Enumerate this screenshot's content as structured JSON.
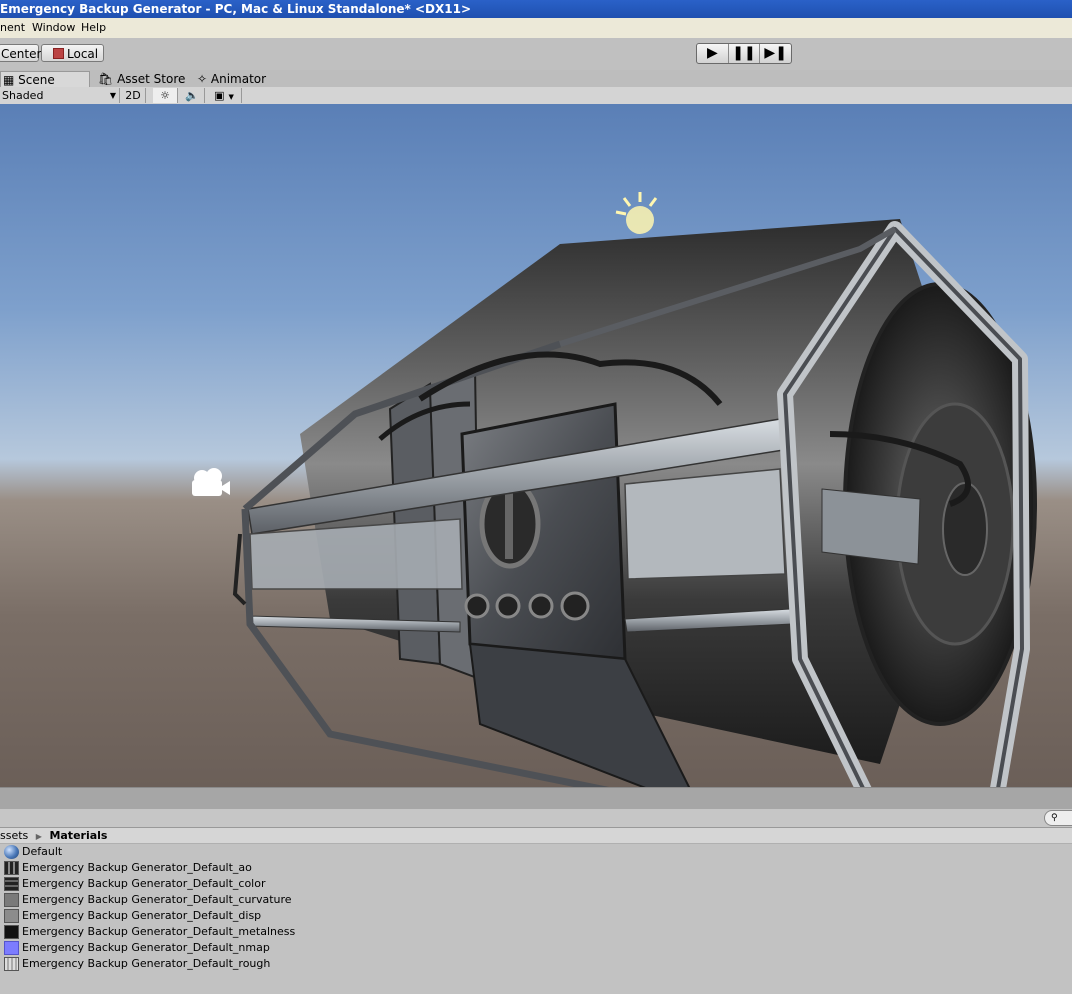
{
  "window": {
    "title": "Emergency Backup Generator - PC, Mac & Linux Standalone* <DX11>"
  },
  "menu": {
    "items": [
      "nent",
      "Window",
      "Help"
    ]
  },
  "toolbar": {
    "pivot": "Center",
    "space": "Local"
  },
  "tabs": [
    {
      "label": "Scene"
    },
    {
      "label": "Asset Store"
    },
    {
      "label": "Animator"
    }
  ],
  "scene_toolbar": {
    "draw_mode": "Shaded",
    "mode_2d": "2D"
  },
  "project": {
    "breadcrumb": {
      "root": "ssets",
      "current": "Materials"
    },
    "items": [
      {
        "label": "Default",
        "thumb": "sphere",
        "color": "#4a78b8"
      },
      {
        "label": "Emergency Backup Generator_Default_ao",
        "thumb": "texture",
        "color": "#5a5a5a"
      },
      {
        "label": "Emergency Backup Generator_Default_color",
        "thumb": "texture",
        "color": "#3a3a3a"
      },
      {
        "label": "Emergency Backup Generator_Default_curvature",
        "thumb": "texture",
        "color": "#7a7a7a"
      },
      {
        "label": "Emergency Backup Generator_Default_disp",
        "thumb": "texture",
        "color": "#8c8c8c"
      },
      {
        "label": "Emergency Backup Generator_Default_metalness",
        "thumb": "texture",
        "color": "#111111"
      },
      {
        "label": "Emergency Backup Generator_Default_nmap",
        "thumb": "texture",
        "color": "#7c7cff"
      },
      {
        "label": "Emergency Backup Generator_Default_rough",
        "thumb": "texture",
        "color": "#d8d8d8"
      }
    ]
  },
  "colors": {
    "title_bar": "#2a61c8",
    "viewport_sky": "#7ea0cc",
    "viewport_ground": "#6b5f58"
  }
}
